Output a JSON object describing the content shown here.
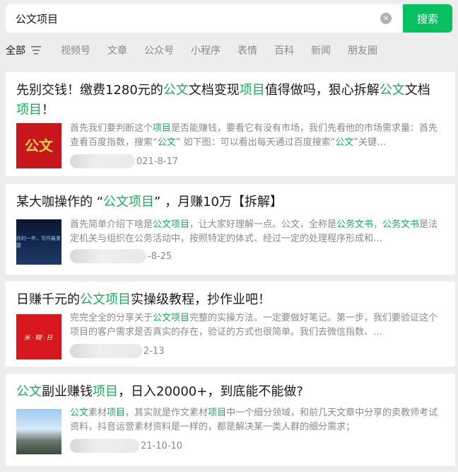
{
  "search": {
    "query": "公文项目",
    "button_label": "搜索",
    "clear_icon": "×"
  },
  "tabs": [
    {
      "label": "全部"
    },
    {
      "label": "视频号"
    },
    {
      "label": "文章"
    },
    {
      "label": "公众号"
    },
    {
      "label": "小程序"
    },
    {
      "label": "表情"
    },
    {
      "label": "百科"
    },
    {
      "label": "新闻"
    },
    {
      "label": "朋友圈"
    }
  ],
  "results": [
    {
      "title_parts": [
        "先别交钱！缴费1280元的",
        "公文",
        "文档变现",
        "项目",
        "值得做吗，狠心拆解",
        "公文",
        "文档",
        "项目",
        "！"
      ],
      "desc_parts": [
        "首先我们要判断这个",
        "项目",
        "是否能赚钱，要看它有没有市场，我们先看他的市场需求量：首先查看百度指数，搜索“",
        "公文",
        "” 如下图：可以看出每天通过百度搜索“",
        "公文",
        "”关键…"
      ],
      "date": "021-8-17",
      "thumb_text": "公文"
    },
    {
      "title_parts": [
        "某大咖操作的 “",
        "公文项目",
        "” ，月赚10万【拆解】"
      ],
      "desc_parts": [
        "首先简单介绍下啥是",
        "公文项目",
        "，让大家好理解一点。公文，全称是",
        "公务文书",
        "，",
        "公务文书",
        "是法定机关与组织在公务活动中，按照特定的体式、经过一定的处理程序形成和…"
      ],
      "date": "-8-25",
      "thumb_text": "你的一年，写作最重要"
    },
    {
      "title_parts": [
        "日赚千元的",
        "公文项目",
        "实操级教程，抄作业吧！"
      ],
      "desc_parts": [
        "完完全全的分享关于",
        "公文项目",
        "完整的实操方法。一定要做好笔记。第一步，我们要验证这个项目的客户需求是否真实的存在，验证的方式也很简单。我们去微信指数、…"
      ],
      "date": "2-13",
      "thumb_text": "米·糊·日"
    },
    {
      "title_parts": [
        "公文",
        "副业赚钱",
        "项目",
        "，日入20000+，到底能不能做?"
      ],
      "desc_parts": [
        "公文",
        "素材",
        "项目",
        "，其实就是作文素材",
        "项目",
        "中一个细分领域，和前几天文章中分享的卖教师考试资料，抖音运营素材资料是一样的，都是解决某一类人群的细分需求；"
      ],
      "date": "21-10-10",
      "thumb_text": ""
    }
  ]
}
